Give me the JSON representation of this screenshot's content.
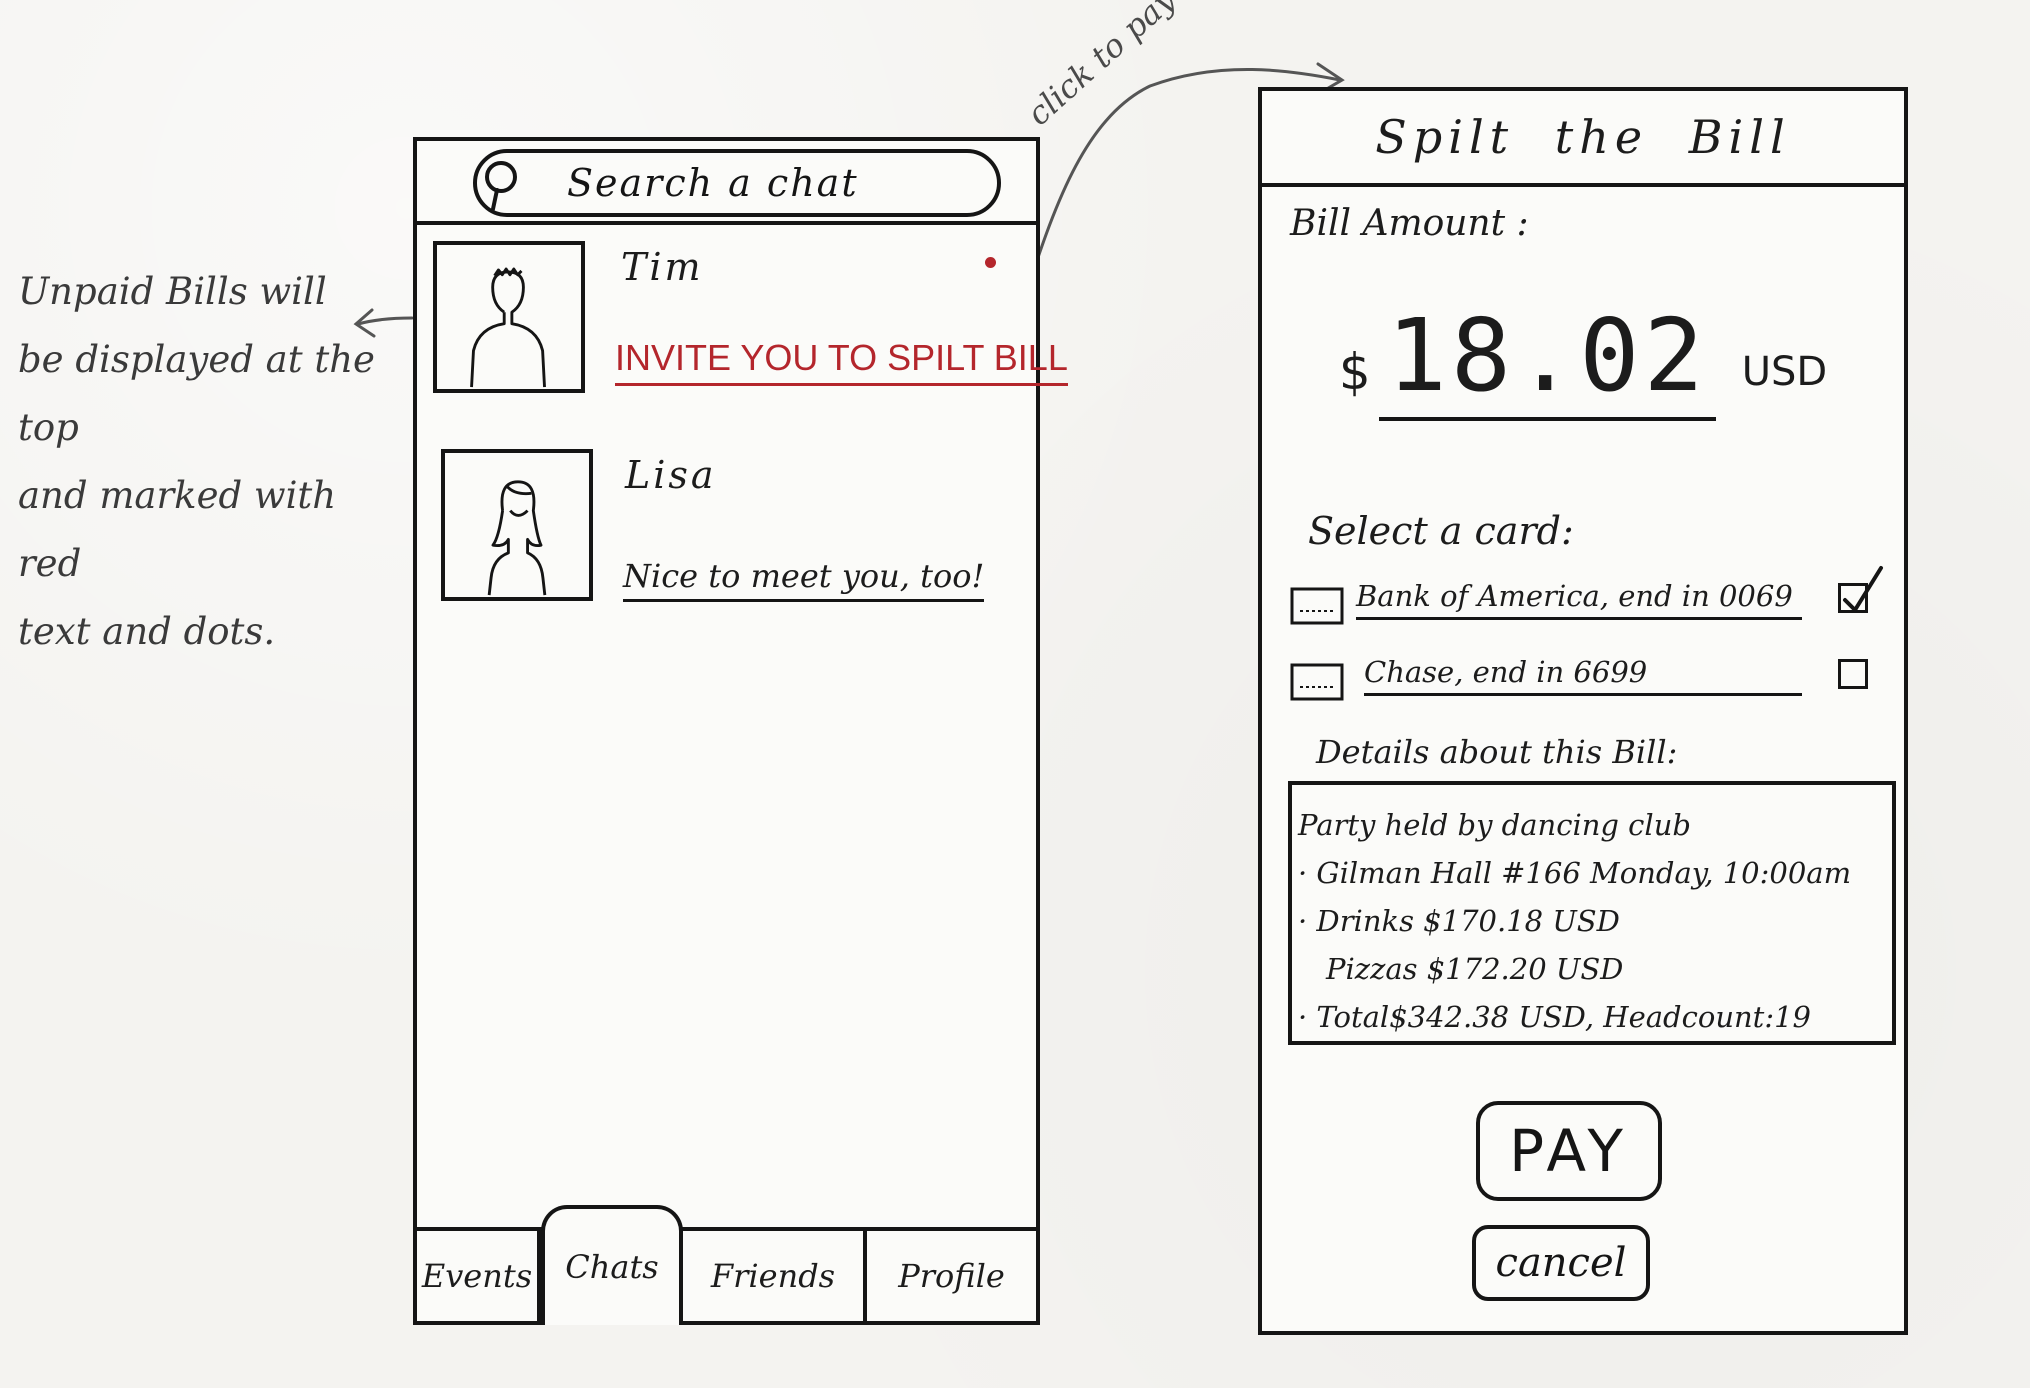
{
  "annotations": {
    "unpaid_note_lines": [
      "Unpaid Bills will",
      "be displayed at the top",
      "and marked with red",
      "text and dots."
    ],
    "arrow_label": "click to pay the bill"
  },
  "chats_screen": {
    "search": {
      "placeholder": "Search a chat",
      "icon": "search-icon"
    },
    "chats": [
      {
        "name": "Tim",
        "preview": "INVITE YOU TO SPILT BILL",
        "unpaid_bill": true,
        "unread_dot": true
      },
      {
        "name": "Lisa",
        "preview": "Nice to meet you, too!",
        "unpaid_bill": false,
        "unread_dot": false
      }
    ],
    "tabs": [
      {
        "label": "Events",
        "active": false
      },
      {
        "label": "Chats",
        "active": true
      },
      {
        "label": "Friends",
        "active": false
      },
      {
        "label": "Profile",
        "active": false
      }
    ]
  },
  "bill_screen": {
    "title": "Spilt the Bill",
    "amount_label": "Bill Amount :",
    "amount": {
      "currency_symbol": "$",
      "value": "18.02",
      "unit": "USD"
    },
    "select_card_label": "Select a card:",
    "cards": [
      {
        "label": "Bank of America, end in 0069",
        "selected": true,
        "icon": "credit-card-icon"
      },
      {
        "label": "Chase, end in 6699",
        "selected": false,
        "icon": "credit-card-icon"
      }
    ],
    "details_label": "Details about this Bill:",
    "details": {
      "line1": "Party held by dancing club",
      "line2": "· Gilman Hall #166   Monday, 10:00am",
      "line3": "· Drinks  $170.18 USD",
      "line4": "  Pizzas  $172.20 USD",
      "line5": "· Total$342.38 USD, Headcount:19"
    },
    "pay_label": "PAY",
    "cancel_label": "cancel"
  },
  "colors": {
    "ink": "#151515",
    "unpaid_red": "#b4262c",
    "paper": "#f4f3f0"
  }
}
